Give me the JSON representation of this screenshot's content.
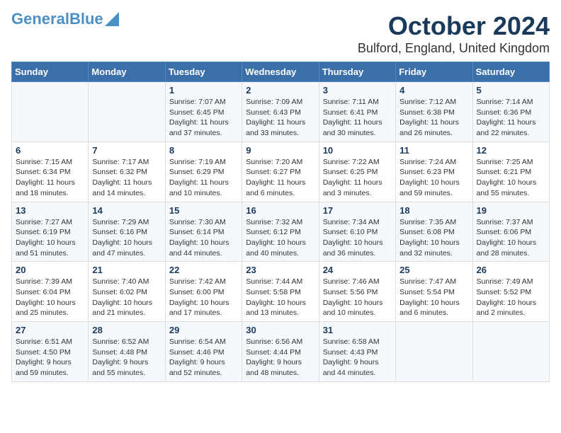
{
  "logo": {
    "line1": "General",
    "line2": "Blue"
  },
  "title": "October 2024",
  "subtitle": "Bulford, England, United Kingdom",
  "days_of_week": [
    "Sunday",
    "Monday",
    "Tuesday",
    "Wednesday",
    "Thursday",
    "Friday",
    "Saturday"
  ],
  "weeks": [
    [
      {
        "day": null,
        "info": null
      },
      {
        "day": null,
        "info": null
      },
      {
        "day": "1",
        "info": "Sunrise: 7:07 AM\nSunset: 6:45 PM\nDaylight: 11 hours and 37 minutes."
      },
      {
        "day": "2",
        "info": "Sunrise: 7:09 AM\nSunset: 6:43 PM\nDaylight: 11 hours and 33 minutes."
      },
      {
        "day": "3",
        "info": "Sunrise: 7:11 AM\nSunset: 6:41 PM\nDaylight: 11 hours and 30 minutes."
      },
      {
        "day": "4",
        "info": "Sunrise: 7:12 AM\nSunset: 6:38 PM\nDaylight: 11 hours and 26 minutes."
      },
      {
        "day": "5",
        "info": "Sunrise: 7:14 AM\nSunset: 6:36 PM\nDaylight: 11 hours and 22 minutes."
      }
    ],
    [
      {
        "day": "6",
        "info": "Sunrise: 7:15 AM\nSunset: 6:34 PM\nDaylight: 11 hours and 18 minutes."
      },
      {
        "day": "7",
        "info": "Sunrise: 7:17 AM\nSunset: 6:32 PM\nDaylight: 11 hours and 14 minutes."
      },
      {
        "day": "8",
        "info": "Sunrise: 7:19 AM\nSunset: 6:29 PM\nDaylight: 11 hours and 10 minutes."
      },
      {
        "day": "9",
        "info": "Sunrise: 7:20 AM\nSunset: 6:27 PM\nDaylight: 11 hours and 6 minutes."
      },
      {
        "day": "10",
        "info": "Sunrise: 7:22 AM\nSunset: 6:25 PM\nDaylight: 11 hours and 3 minutes."
      },
      {
        "day": "11",
        "info": "Sunrise: 7:24 AM\nSunset: 6:23 PM\nDaylight: 10 hours and 59 minutes."
      },
      {
        "day": "12",
        "info": "Sunrise: 7:25 AM\nSunset: 6:21 PM\nDaylight: 10 hours and 55 minutes."
      }
    ],
    [
      {
        "day": "13",
        "info": "Sunrise: 7:27 AM\nSunset: 6:19 PM\nDaylight: 10 hours and 51 minutes."
      },
      {
        "day": "14",
        "info": "Sunrise: 7:29 AM\nSunset: 6:16 PM\nDaylight: 10 hours and 47 minutes."
      },
      {
        "day": "15",
        "info": "Sunrise: 7:30 AM\nSunset: 6:14 PM\nDaylight: 10 hours and 44 minutes."
      },
      {
        "day": "16",
        "info": "Sunrise: 7:32 AM\nSunset: 6:12 PM\nDaylight: 10 hours and 40 minutes."
      },
      {
        "day": "17",
        "info": "Sunrise: 7:34 AM\nSunset: 6:10 PM\nDaylight: 10 hours and 36 minutes."
      },
      {
        "day": "18",
        "info": "Sunrise: 7:35 AM\nSunset: 6:08 PM\nDaylight: 10 hours and 32 minutes."
      },
      {
        "day": "19",
        "info": "Sunrise: 7:37 AM\nSunset: 6:06 PM\nDaylight: 10 hours and 28 minutes."
      }
    ],
    [
      {
        "day": "20",
        "info": "Sunrise: 7:39 AM\nSunset: 6:04 PM\nDaylight: 10 hours and 25 minutes."
      },
      {
        "day": "21",
        "info": "Sunrise: 7:40 AM\nSunset: 6:02 PM\nDaylight: 10 hours and 21 minutes."
      },
      {
        "day": "22",
        "info": "Sunrise: 7:42 AM\nSunset: 6:00 PM\nDaylight: 10 hours and 17 minutes."
      },
      {
        "day": "23",
        "info": "Sunrise: 7:44 AM\nSunset: 5:58 PM\nDaylight: 10 hours and 13 minutes."
      },
      {
        "day": "24",
        "info": "Sunrise: 7:46 AM\nSunset: 5:56 PM\nDaylight: 10 hours and 10 minutes."
      },
      {
        "day": "25",
        "info": "Sunrise: 7:47 AM\nSunset: 5:54 PM\nDaylight: 10 hours and 6 minutes."
      },
      {
        "day": "26",
        "info": "Sunrise: 7:49 AM\nSunset: 5:52 PM\nDaylight: 10 hours and 2 minutes."
      }
    ],
    [
      {
        "day": "27",
        "info": "Sunrise: 6:51 AM\nSunset: 4:50 PM\nDaylight: 9 hours and 59 minutes."
      },
      {
        "day": "28",
        "info": "Sunrise: 6:52 AM\nSunset: 4:48 PM\nDaylight: 9 hours and 55 minutes."
      },
      {
        "day": "29",
        "info": "Sunrise: 6:54 AM\nSunset: 4:46 PM\nDaylight: 9 hours and 52 minutes."
      },
      {
        "day": "30",
        "info": "Sunrise: 6:56 AM\nSunset: 4:44 PM\nDaylight: 9 hours and 48 minutes."
      },
      {
        "day": "31",
        "info": "Sunrise: 6:58 AM\nSunset: 4:43 PM\nDaylight: 9 hours and 44 minutes."
      },
      {
        "day": null,
        "info": null
      },
      {
        "day": null,
        "info": null
      }
    ]
  ]
}
